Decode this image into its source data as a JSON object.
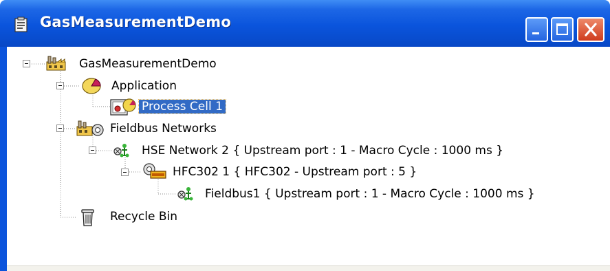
{
  "window": {
    "title": "GasMeasurementDemo",
    "title_bar_color": "#0a54dc",
    "selection_color": "#316ac5"
  },
  "tree": {
    "root": {
      "label": "GasMeasurementDemo",
      "icon": "factory-icon",
      "expanded": true
    },
    "application": {
      "label": "Application",
      "icon": "application-pie-icon",
      "expanded": true
    },
    "process_cell": {
      "label": "Process Cell 1",
      "icon": "process-cell-icon",
      "selected": true
    },
    "fieldbus_networks": {
      "label": "Fieldbus Networks",
      "icon": "fieldbus-networks-icon",
      "expanded": true
    },
    "hse_network": {
      "label": "HSE Network 2 { Upstream port : 1 -  Macro Cycle : 1000 ms  }",
      "icon": "network-icon",
      "expanded": true
    },
    "hfc302": {
      "label": "HFC302 1 { HFC302 - Upstream port : 5 }",
      "icon": "hfc-device-icon",
      "expanded": true
    },
    "fieldbus1": {
      "label": "Fieldbus1 {  Upstream port : 1 -  Macro Cycle : 1000 ms  }",
      "icon": "network-icon"
    },
    "recycle_bin": {
      "label": "Recycle Bin",
      "icon": "recycle-bin-icon"
    }
  }
}
